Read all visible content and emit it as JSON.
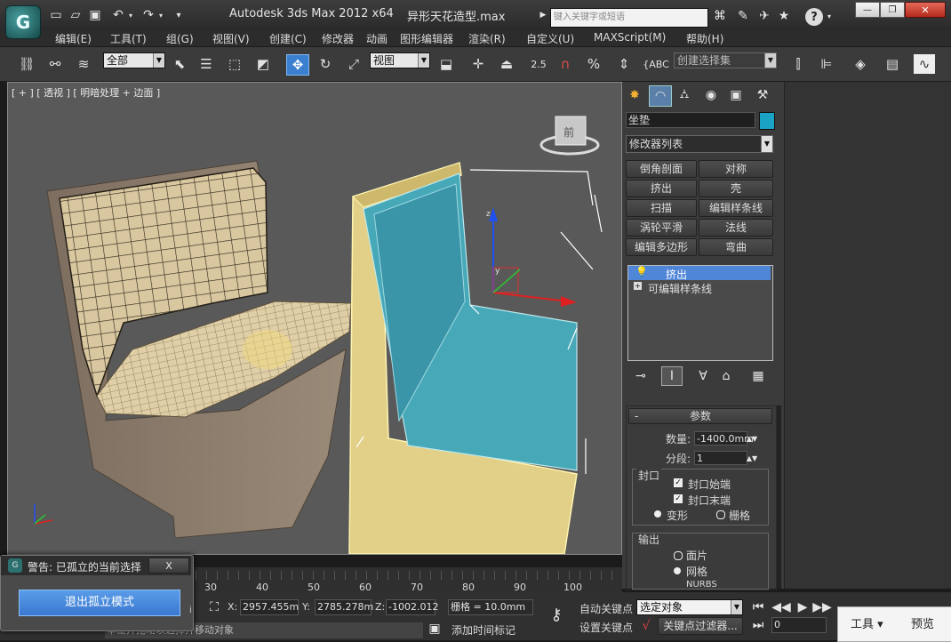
{
  "titlebar": {
    "app_title": "Autodesk 3ds Max  2012 x64",
    "file_name": "异形天花造型.max",
    "search_placeholder": "键入关键字或短语",
    "tools_label": "工具",
    "preview_label": "预览"
  },
  "menu": {
    "items": [
      "编辑(E)",
      "工具(T)",
      "组(G)",
      "视图(V)",
      "创建(C)",
      "修改器",
      "动画",
      "图形编辑器",
      "渲染(R)",
      "自定义(U)",
      "MAXScript(M)",
      "帮助(H)"
    ]
  },
  "toolbar": {
    "selection_filter": "全部",
    "ref_coord": "视图",
    "snap_angle": "2.5",
    "percent": "%",
    "named_selection": "创建选择集"
  },
  "viewport": {
    "label": "[ + ] [ 透视 ] [ 明暗处理 + 边面 ]",
    "viewcube_face": "前"
  },
  "command_panel": {
    "object_name": "坐垫",
    "object_color": "#1aa3c4",
    "modifier_list": "修改器列表",
    "modifier_buttons": [
      "倒角剖面",
      "对称",
      "挤出",
      "壳",
      "扫描",
      "编辑样条线",
      "涡轮平滑",
      "法线",
      "编辑多边形",
      "弯曲"
    ],
    "stack": [
      "挤出",
      "可编辑样条线"
    ],
    "rollout_title": "参数",
    "amount_label": "数量:",
    "amount_value": "-1400.0mm",
    "segments_label": "分段:",
    "segments_value": "1",
    "capping_title": "封口",
    "cap_start": "封口始端",
    "cap_end": "封口末端",
    "morph": "变形",
    "grid": "栅格",
    "output_title": "输出",
    "patch": "面片",
    "mesh": "网格",
    "nurbs": "NURBS"
  },
  "timeline": {
    "ticks": [
      "30",
      "40",
      "50",
      "60",
      "70",
      "80",
      "90",
      "100"
    ]
  },
  "isolate": {
    "title": "警告: 已孤立的当前选择",
    "close": "X",
    "exit_button": "退出孤立模式"
  },
  "status": {
    "x_label": "X:",
    "x_value": "2957.455m",
    "y_label": "Y:",
    "y_value": "2785.278m",
    "z_label": "Z:",
    "z_value": "-1002.012",
    "grid_text": "栅格 = 10.0mm",
    "auto_key": "自动关键点",
    "selected_object": "选定对象",
    "set_key": "设置关键点",
    "key_filter": "关键点过滤器...",
    "frame": "0",
    "add_time_tag": "添加时间标记",
    "prompt": "单击并拖动以选择并移动对象"
  }
}
